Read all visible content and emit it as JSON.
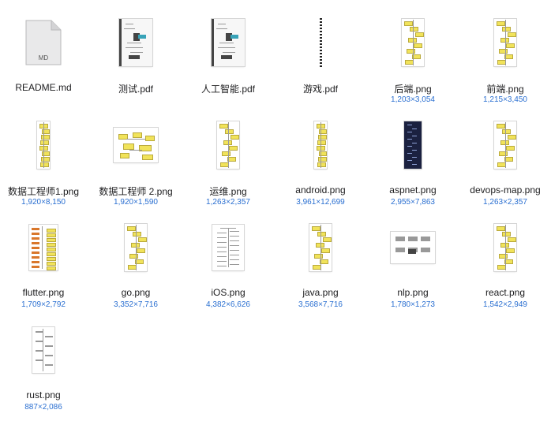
{
  "files": [
    {
      "name": "README.md",
      "dims": "",
      "type": "md-icon",
      "badge": "MD"
    },
    {
      "name": "测试.pdf",
      "dims": "",
      "type": "pdf-mindmap"
    },
    {
      "name": "人工智能.pdf",
      "dims": "",
      "type": "pdf-mindmap"
    },
    {
      "name": "游戏.pdf",
      "dims": "",
      "type": "pdf-strip"
    },
    {
      "name": "后端.png",
      "dims": "1,203×3,054",
      "type": "roadmap-yellow"
    },
    {
      "name": "前端.png",
      "dims": "1,215×3,450",
      "type": "roadmap-yellow"
    },
    {
      "name": "数据工程师1.png",
      "dims": "1,920×8,150",
      "type": "roadmap-narrow"
    },
    {
      "name": "数据工程师 2.png",
      "dims": "1,920×1,590",
      "type": "roadmap-wide"
    },
    {
      "name": "运维.png",
      "dims": "1,263×2,357",
      "type": "roadmap-yellow"
    },
    {
      "name": "android.png",
      "dims": "3,961×12,699",
      "type": "roadmap-narrow"
    },
    {
      "name": "aspnet.png",
      "dims": "2,955×7,863",
      "type": "roadmap-dark"
    },
    {
      "name": "devops-map.png",
      "dims": "1,263×2,357",
      "type": "roadmap-yellow"
    },
    {
      "name": "flutter.png",
      "dims": "1,709×2,792",
      "type": "roadmap-orange"
    },
    {
      "name": "go.png",
      "dims": "3,352×7,716",
      "type": "roadmap-yellow"
    },
    {
      "name": "iOS.png",
      "dims": "4,382×6,626",
      "type": "roadmap-lines"
    },
    {
      "name": "java.png",
      "dims": "3,568×7,716",
      "type": "roadmap-yellow"
    },
    {
      "name": "nlp.png",
      "dims": "1,780×1,273",
      "type": "roadmap-gray"
    },
    {
      "name": "react.png",
      "dims": "1,542×2,949",
      "type": "roadmap-yellow"
    },
    {
      "name": "rust.png",
      "dims": "887×2,086",
      "type": "roadmap-white"
    }
  ],
  "colors": {
    "link": "#2a6fd1",
    "highlight": "#f1e35a"
  }
}
